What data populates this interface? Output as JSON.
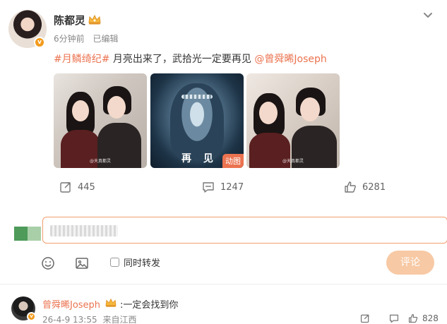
{
  "post": {
    "author": "陈都灵",
    "time": "6分钟前",
    "edited": "已编辑",
    "verified_badge": "v",
    "text": {
      "topic": "#月鳞绮纪#",
      "body": " 月亮出来了，武拾光一定要再见 ",
      "mention": "@曾舜晞Joseph"
    },
    "images": [
      {
        "alt": "photo-1",
        "watermark": "@天真都灵"
      },
      {
        "alt": "photo-2",
        "caption": "再 见",
        "badge": "动图"
      },
      {
        "alt": "photo-3",
        "watermark": "@天真都灵"
      }
    ],
    "actions": {
      "share_count": "445",
      "comment_count": "1247",
      "like_count": "6281"
    }
  },
  "composer": {
    "repost_label": "同时转发",
    "submit_label": "评论"
  },
  "reply": {
    "author": "曾舜晞Joseph",
    "text": ":一定会找到你",
    "date": "26-4-9 13:55",
    "source": "来自江西",
    "like_count": "828",
    "verified_badge": "v"
  },
  "colors": {
    "accent": "#eb7350",
    "submit_disabled": "#f7c9a4",
    "verified": "#f29b1d"
  }
}
